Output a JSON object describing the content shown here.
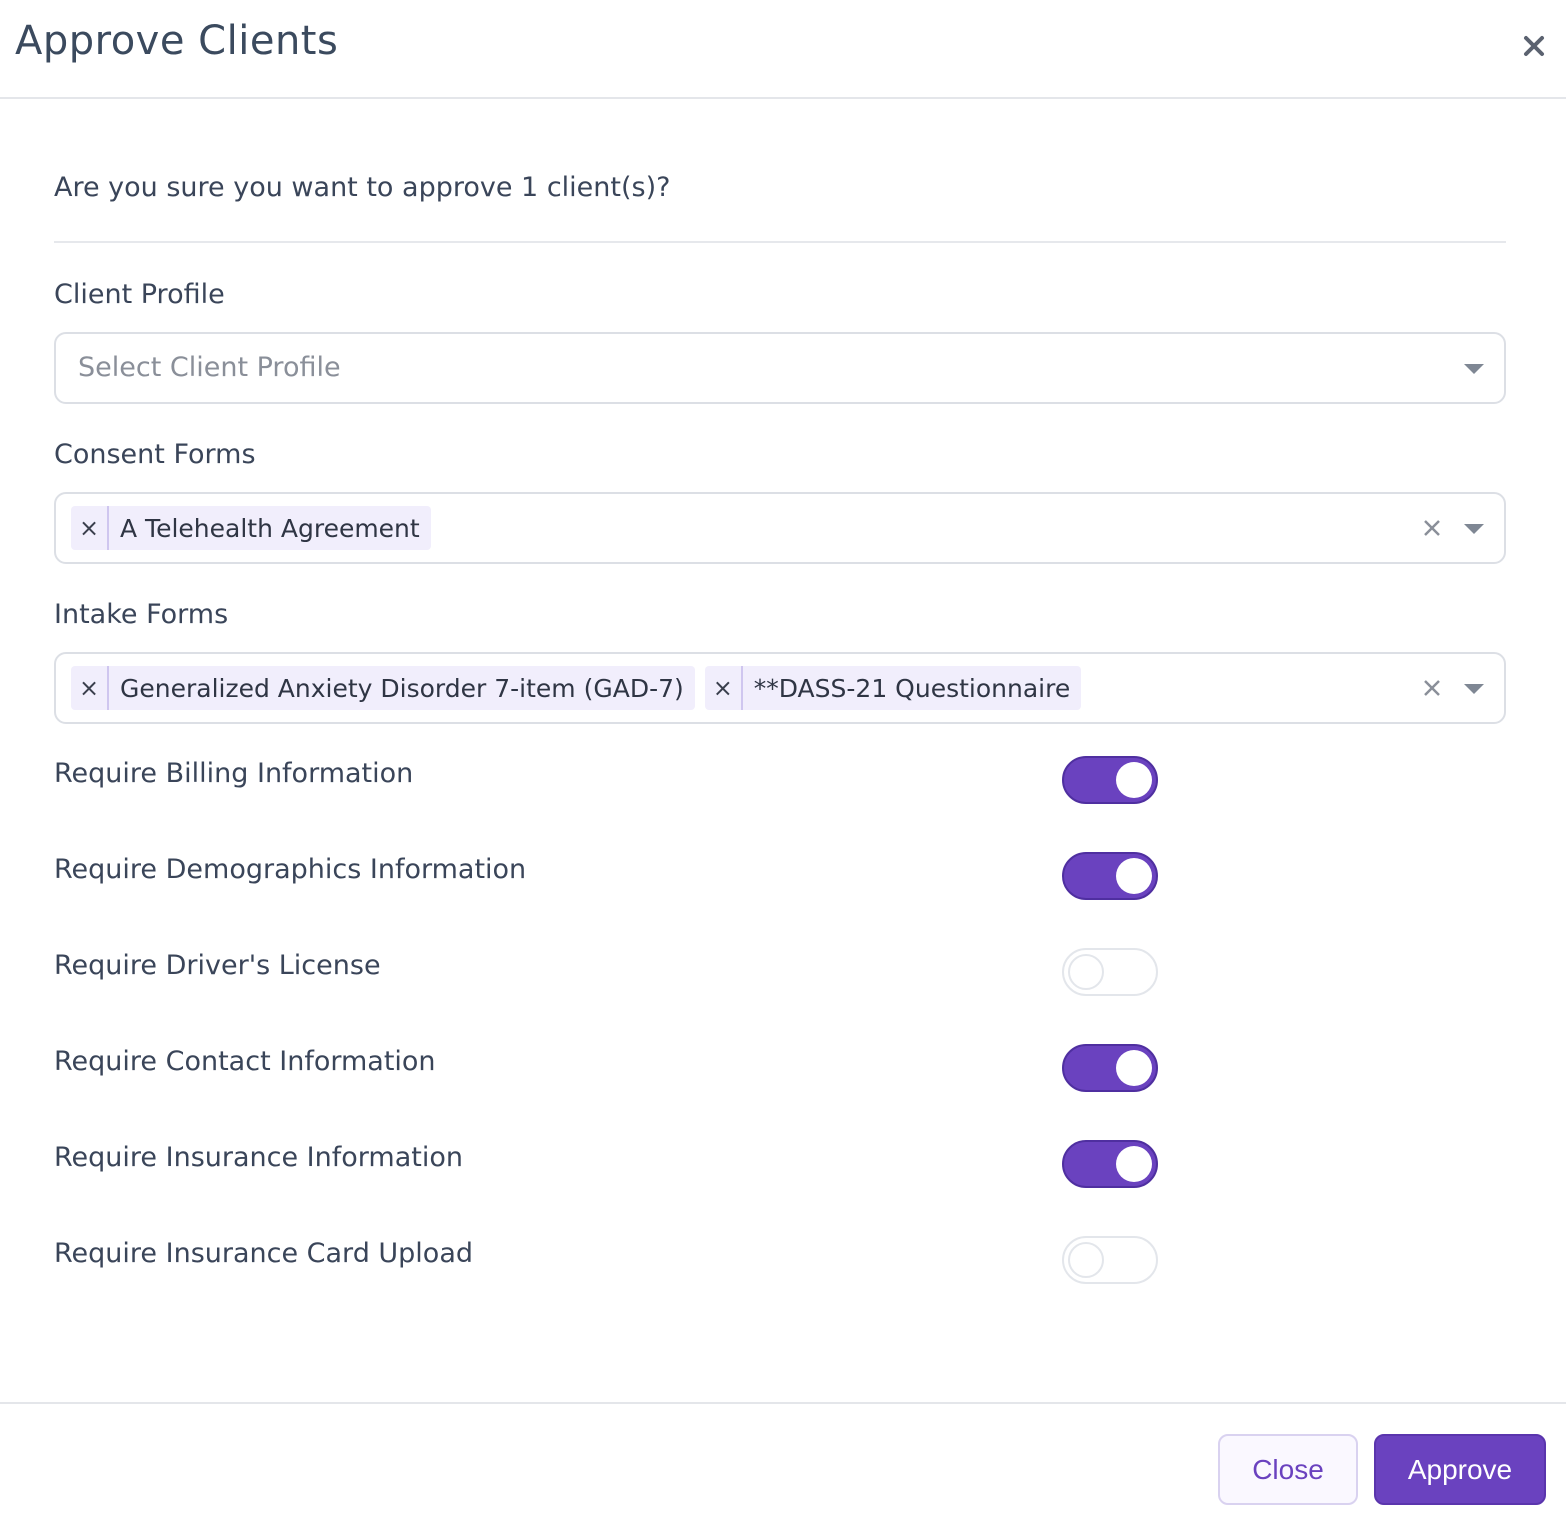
{
  "dialog": {
    "title": "Approve Clients",
    "question": "Are you sure you want to approve 1 client(s)?"
  },
  "client_profile": {
    "label": "Client Profile",
    "placeholder": "Select Client Profile"
  },
  "consent_forms": {
    "label": "Consent Forms",
    "selected": [
      "A Telehealth Agreement"
    ]
  },
  "intake_forms": {
    "label": "Intake Forms",
    "selected": [
      "Generalized Anxiety Disorder 7-item (GAD-7)",
      "**DASS-21 Questionnaire"
    ]
  },
  "tag_remove_symbol": "×",
  "toggles": [
    {
      "label": "Require Billing Information",
      "on": true
    },
    {
      "label": "Require Demographics Information",
      "on": true
    },
    {
      "label": "Require Driver's License",
      "on": false
    },
    {
      "label": "Require Contact Information",
      "on": true
    },
    {
      "label": "Require Insurance Information",
      "on": true
    },
    {
      "label": "Require Insurance Card Upload",
      "on": false
    }
  ],
  "footer": {
    "close_label": "Close",
    "approve_label": "Approve"
  },
  "colors": {
    "accent": "#6a42bf",
    "tag_bg": "#f1eefc"
  }
}
